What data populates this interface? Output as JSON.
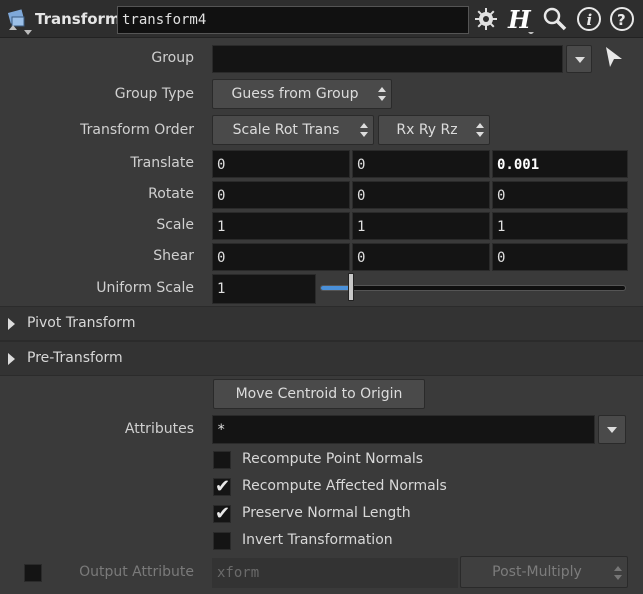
{
  "header": {
    "node_type": "Transform",
    "node_name": "transform4"
  },
  "params": {
    "group": {
      "label": "Group",
      "value": ""
    },
    "group_type": {
      "label": "Group Type",
      "value": "Guess from Group"
    },
    "transform_order": {
      "label": "Transform Order",
      "value": "Scale Rot Trans",
      "rot_order": "Rx Ry Rz"
    },
    "translate": {
      "label": "Translate",
      "values": [
        "0",
        "0",
        "0.001"
      ]
    },
    "rotate": {
      "label": "Rotate",
      "values": [
        "0",
        "0",
        "0"
      ]
    },
    "scale": {
      "label": "Scale",
      "values": [
        "1",
        "1",
        "1"
      ]
    },
    "shear": {
      "label": "Shear",
      "values": [
        "0",
        "0",
        "0"
      ]
    },
    "uniform_scale": {
      "label": "Uniform Scale",
      "value": "1",
      "slider_fraction": 0.1
    }
  },
  "sections": {
    "pivot": "Pivot Transform",
    "pre": "Pre-Transform"
  },
  "move_centroid_label": "Move Centroid to Origin",
  "attributes": {
    "label": "Attributes",
    "value": "*"
  },
  "checkboxes": {
    "recompute_point_normals": {
      "label": "Recompute Point Normals",
      "checked": false
    },
    "recompute_affected_normals": {
      "label": "Recompute Affected Normals",
      "checked": true
    },
    "preserve_normal_length": {
      "label": "Preserve Normal Length",
      "checked": true
    },
    "invert_transformation": {
      "label": "Invert Transformation",
      "checked": false
    }
  },
  "output_attribute": {
    "label": "Output Attribute",
    "value": "xform",
    "mode": "Post-Multiply",
    "enabled": false
  },
  "colors": {
    "accent": "#4a90d9",
    "panel": "#3a3a3a",
    "field": "#141414"
  },
  "icons": [
    "gear-icon",
    "houdini-help-icon",
    "search-icon",
    "info-icon",
    "help-icon"
  ]
}
